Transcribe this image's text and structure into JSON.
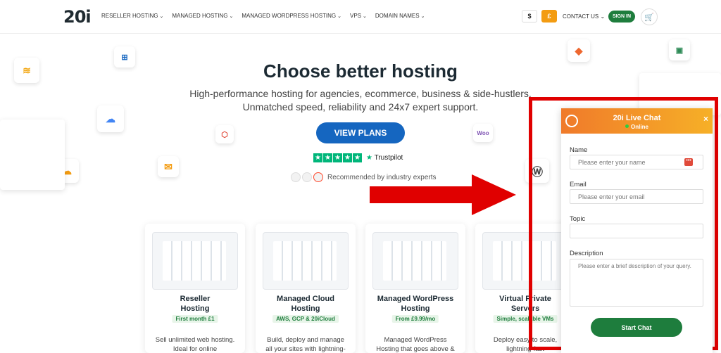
{
  "nav": {
    "logo": "20i",
    "menu": [
      {
        "label": "RESELLER HOSTING"
      },
      {
        "label": "MANAGED HOSTING"
      },
      {
        "label": "MANAGED WORDPRESS HOSTING"
      },
      {
        "label": "VPS"
      },
      {
        "label": "DOMAIN NAMES"
      }
    ],
    "currency": [
      "$",
      "£"
    ],
    "contact": "CONTACT US",
    "signin": "SIGN IN"
  },
  "hero": {
    "title": "Choose better hosting",
    "subtitle_line1": "High-performance hosting for agencies, ecommerce, business & side-hustlers.",
    "subtitle_line2": "Unmatched speed, reliability and 24x7 expert support.",
    "cta": "VIEW PLANS",
    "trustpilot": "Trustpilot",
    "recommended": "Recommended by industry experts"
  },
  "cards": [
    {
      "name_1": "Reseller",
      "name_2": "Hosting",
      "tag": "First month £1",
      "desc_1": "Sell unlimited web hosting.",
      "desc_2": "Ideal for online"
    },
    {
      "name_1": "Managed Cloud",
      "name_2": "Hosting",
      "tag": "AWS, GCP & 20iCloud",
      "desc_1": "Build, deploy and manage",
      "desc_2": "all your sites with lightning-"
    },
    {
      "name_1": "Managed WordPress",
      "name_2": "Hosting",
      "tag": "From £9.99/mo",
      "desc_1": "Managed WordPress",
      "desc_2": "Hosting that goes above &"
    },
    {
      "name_1": "Virtual Private",
      "name_2": "Servers",
      "tag": "Simple, scalable VMs",
      "desc_1": "Deploy easy to scale,",
      "desc_2": "lightning-fast"
    }
  ],
  "chat": {
    "title": "20i Live Chat",
    "status": "Online",
    "close": "×",
    "name_label": "Name",
    "name_placeholder": "Please enter your name",
    "email_label": "Email",
    "email_placeholder": "Please enter your email",
    "topic_label": "Topic",
    "description_label": "Description",
    "description_placeholder": "Please enter a brief description of your query.",
    "start_button": "Start Chat"
  },
  "colors": {
    "accent_orange": "#f39c12",
    "primary_blue": "#1566c0",
    "green": "#1e7d3d",
    "highlight_red": "#e00000"
  }
}
